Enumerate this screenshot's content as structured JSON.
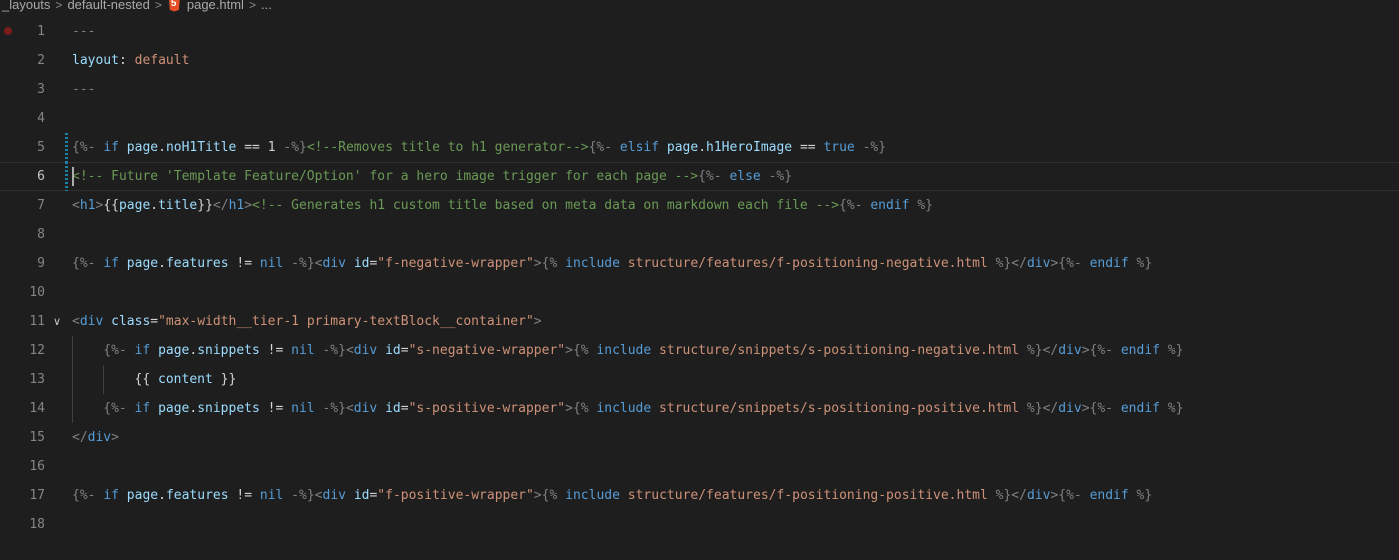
{
  "breadcrumb": {
    "items": [
      "_layouts",
      "default-nested",
      "page.html",
      "..."
    ],
    "separator": ">"
  },
  "editor": {
    "current_line": 6,
    "lines": [
      {
        "num": "1",
        "breakpoint": true,
        "tokens": [
          {
            "t": "---",
            "c": "delim"
          }
        ]
      },
      {
        "num": "2",
        "tokens": [
          {
            "t": "layout",
            "c": "var"
          },
          {
            "t": ": ",
            "c": "plain"
          },
          {
            "t": "default",
            "c": "str"
          }
        ]
      },
      {
        "num": "3",
        "tokens": [
          {
            "t": "---",
            "c": "delim"
          }
        ]
      },
      {
        "num": "4",
        "tokens": []
      },
      {
        "num": "5",
        "modified": true,
        "tokens": [
          {
            "t": "{%- ",
            "c": "delim"
          },
          {
            "t": "if",
            "c": "key"
          },
          {
            "t": " ",
            "c": "plain"
          },
          {
            "t": "page",
            "c": "var"
          },
          {
            "t": ".",
            "c": "plain"
          },
          {
            "t": "noH1Title",
            "c": "var"
          },
          {
            "t": " == ",
            "c": "plain"
          },
          {
            "t": "1",
            "c": "plain"
          },
          {
            "t": " -%}",
            "c": "delim"
          },
          {
            "t": "<!--Removes title to h1 generator-->",
            "c": "com"
          },
          {
            "t": "{%- ",
            "c": "delim"
          },
          {
            "t": "elsif",
            "c": "key"
          },
          {
            "t": " ",
            "c": "plain"
          },
          {
            "t": "page",
            "c": "var"
          },
          {
            "t": ".",
            "c": "plain"
          },
          {
            "t": "h1HeroImage",
            "c": "var"
          },
          {
            "t": " == ",
            "c": "plain"
          },
          {
            "t": "true",
            "c": "key"
          },
          {
            "t": " -%}",
            "c": "delim"
          }
        ]
      },
      {
        "num": "6",
        "modified": true,
        "tokens": [
          {
            "t": "<!-- Future 'Template Feature/Option' for a hero image trigger for each page -->",
            "c": "com"
          },
          {
            "t": "{%- ",
            "c": "delim"
          },
          {
            "t": "else",
            "c": "key"
          },
          {
            "t": " -%}",
            "c": "delim"
          }
        ]
      },
      {
        "num": "7",
        "tokens": [
          {
            "t": "<",
            "c": "delim"
          },
          {
            "t": "h1",
            "c": "tag"
          },
          {
            "t": ">",
            "c": "delim"
          },
          {
            "t": "{{",
            "c": "plain"
          },
          {
            "t": "page",
            "c": "var"
          },
          {
            "t": ".",
            "c": "plain"
          },
          {
            "t": "title",
            "c": "var"
          },
          {
            "t": "}}",
            "c": "plain"
          },
          {
            "t": "</",
            "c": "delim"
          },
          {
            "t": "h1",
            "c": "tag"
          },
          {
            "t": ">",
            "c": "delim"
          },
          {
            "t": "<!-- Generates h1 custom title based on meta data on markdown each file -->",
            "c": "com"
          },
          {
            "t": "{%- ",
            "c": "delim"
          },
          {
            "t": "endif",
            "c": "key"
          },
          {
            "t": " %}",
            "c": "delim"
          }
        ]
      },
      {
        "num": "8",
        "tokens": []
      },
      {
        "num": "9",
        "tokens": [
          {
            "t": "{%- ",
            "c": "delim"
          },
          {
            "t": "if",
            "c": "key"
          },
          {
            "t": " ",
            "c": "plain"
          },
          {
            "t": "page",
            "c": "var"
          },
          {
            "t": ".",
            "c": "plain"
          },
          {
            "t": "features",
            "c": "var"
          },
          {
            "t": " != ",
            "c": "plain"
          },
          {
            "t": "nil",
            "c": "key"
          },
          {
            "t": " -%}",
            "c": "delim"
          },
          {
            "t": "<",
            "c": "delim"
          },
          {
            "t": "div",
            "c": "tag"
          },
          {
            "t": " ",
            "c": "plain"
          },
          {
            "t": "id",
            "c": "var"
          },
          {
            "t": "=",
            "c": "plain"
          },
          {
            "t": "\"f-negative-wrapper\"",
            "c": "str"
          },
          {
            "t": ">",
            "c": "delim"
          },
          {
            "t": "{% ",
            "c": "delim"
          },
          {
            "t": "include",
            "c": "key"
          },
          {
            "t": " ",
            "c": "plain"
          },
          {
            "t": "structure/features/f-positioning-negative.html",
            "c": "str"
          },
          {
            "t": " %}",
            "c": "delim"
          },
          {
            "t": "</",
            "c": "delim"
          },
          {
            "t": "div",
            "c": "tag"
          },
          {
            "t": ">",
            "c": "delim"
          },
          {
            "t": "{%- ",
            "c": "delim"
          },
          {
            "t": "endif",
            "c": "key"
          },
          {
            "t": " %}",
            "c": "delim"
          }
        ]
      },
      {
        "num": "10",
        "tokens": []
      },
      {
        "num": "11",
        "fold": true,
        "tokens": [
          {
            "t": "<",
            "c": "delim"
          },
          {
            "t": "div",
            "c": "tag"
          },
          {
            "t": " ",
            "c": "plain"
          },
          {
            "t": "class",
            "c": "var"
          },
          {
            "t": "=",
            "c": "plain"
          },
          {
            "t": "\"max-width__tier-1 primary-textBlock__container\"",
            "c": "str"
          },
          {
            "t": ">",
            "c": "delim"
          }
        ]
      },
      {
        "num": "12",
        "indent": 1,
        "tokens": [
          {
            "t": "{%- ",
            "c": "delim"
          },
          {
            "t": "if",
            "c": "key"
          },
          {
            "t": " ",
            "c": "plain"
          },
          {
            "t": "page",
            "c": "var"
          },
          {
            "t": ".",
            "c": "plain"
          },
          {
            "t": "snippets",
            "c": "var"
          },
          {
            "t": " != ",
            "c": "plain"
          },
          {
            "t": "nil",
            "c": "key"
          },
          {
            "t": " -%}",
            "c": "delim"
          },
          {
            "t": "<",
            "c": "delim"
          },
          {
            "t": "div",
            "c": "tag"
          },
          {
            "t": " ",
            "c": "plain"
          },
          {
            "t": "id",
            "c": "var"
          },
          {
            "t": "=",
            "c": "plain"
          },
          {
            "t": "\"s-negative-wrapper\"",
            "c": "str"
          },
          {
            "t": ">",
            "c": "delim"
          },
          {
            "t": "{% ",
            "c": "delim"
          },
          {
            "t": "include",
            "c": "key"
          },
          {
            "t": " ",
            "c": "plain"
          },
          {
            "t": "structure/snippets/s-positioning-negative.html",
            "c": "str"
          },
          {
            "t": " %}",
            "c": "delim"
          },
          {
            "t": "</",
            "c": "delim"
          },
          {
            "t": "div",
            "c": "tag"
          },
          {
            "t": ">",
            "c": "delim"
          },
          {
            "t": "{%- ",
            "c": "delim"
          },
          {
            "t": "endif",
            "c": "key"
          },
          {
            "t": " %}",
            "c": "delim"
          }
        ]
      },
      {
        "num": "13",
        "indent": 2,
        "tokens": [
          {
            "t": "{{ ",
            "c": "plain"
          },
          {
            "t": "content",
            "c": "var"
          },
          {
            "t": " }}",
            "c": "plain"
          }
        ]
      },
      {
        "num": "14",
        "indent": 1,
        "tokens": [
          {
            "t": "{%- ",
            "c": "delim"
          },
          {
            "t": "if",
            "c": "key"
          },
          {
            "t": " ",
            "c": "plain"
          },
          {
            "t": "page",
            "c": "var"
          },
          {
            "t": ".",
            "c": "plain"
          },
          {
            "t": "snippets",
            "c": "var"
          },
          {
            "t": " != ",
            "c": "plain"
          },
          {
            "t": "nil",
            "c": "key"
          },
          {
            "t": " -%}",
            "c": "delim"
          },
          {
            "t": "<",
            "c": "delim"
          },
          {
            "t": "div",
            "c": "tag"
          },
          {
            "t": " ",
            "c": "plain"
          },
          {
            "t": "id",
            "c": "var"
          },
          {
            "t": "=",
            "c": "plain"
          },
          {
            "t": "\"s-positive-wrapper\"",
            "c": "str"
          },
          {
            "t": ">",
            "c": "delim"
          },
          {
            "t": "{% ",
            "c": "delim"
          },
          {
            "t": "include",
            "c": "key"
          },
          {
            "t": " ",
            "c": "plain"
          },
          {
            "t": "structure/snippets/s-positioning-positive.html",
            "c": "str"
          },
          {
            "t": " %}",
            "c": "delim"
          },
          {
            "t": "</",
            "c": "delim"
          },
          {
            "t": "div",
            "c": "tag"
          },
          {
            "t": ">",
            "c": "delim"
          },
          {
            "t": "{%- ",
            "c": "delim"
          },
          {
            "t": "endif",
            "c": "key"
          },
          {
            "t": " %}",
            "c": "delim"
          }
        ]
      },
      {
        "num": "15",
        "tokens": [
          {
            "t": "</",
            "c": "delim"
          },
          {
            "t": "div",
            "c": "tag"
          },
          {
            "t": ">",
            "c": "delim"
          }
        ]
      },
      {
        "num": "16",
        "tokens": []
      },
      {
        "num": "17",
        "tokens": [
          {
            "t": "{%- ",
            "c": "delim"
          },
          {
            "t": "if",
            "c": "key"
          },
          {
            "t": " ",
            "c": "plain"
          },
          {
            "t": "page",
            "c": "var"
          },
          {
            "t": ".",
            "c": "plain"
          },
          {
            "t": "features",
            "c": "var"
          },
          {
            "t": " != ",
            "c": "plain"
          },
          {
            "t": "nil",
            "c": "key"
          },
          {
            "t": " -%}",
            "c": "delim"
          },
          {
            "t": "<",
            "c": "delim"
          },
          {
            "t": "div",
            "c": "tag"
          },
          {
            "t": " ",
            "c": "plain"
          },
          {
            "t": "id",
            "c": "var"
          },
          {
            "t": "=",
            "c": "plain"
          },
          {
            "t": "\"f-positive-wrapper\"",
            "c": "str"
          },
          {
            "t": ">",
            "c": "delim"
          },
          {
            "t": "{% ",
            "c": "delim"
          },
          {
            "t": "include",
            "c": "key"
          },
          {
            "t": " ",
            "c": "plain"
          },
          {
            "t": "structure/features/f-positioning-positive.html",
            "c": "str"
          },
          {
            "t": " %}",
            "c": "delim"
          },
          {
            "t": "</",
            "c": "delim"
          },
          {
            "t": "div",
            "c": "tag"
          },
          {
            "t": ">",
            "c": "delim"
          },
          {
            "t": "{%- ",
            "c": "delim"
          },
          {
            "t": "endif",
            "c": "key"
          },
          {
            "t": " %}",
            "c": "delim"
          }
        ]
      },
      {
        "num": "18",
        "tokens": []
      }
    ]
  }
}
